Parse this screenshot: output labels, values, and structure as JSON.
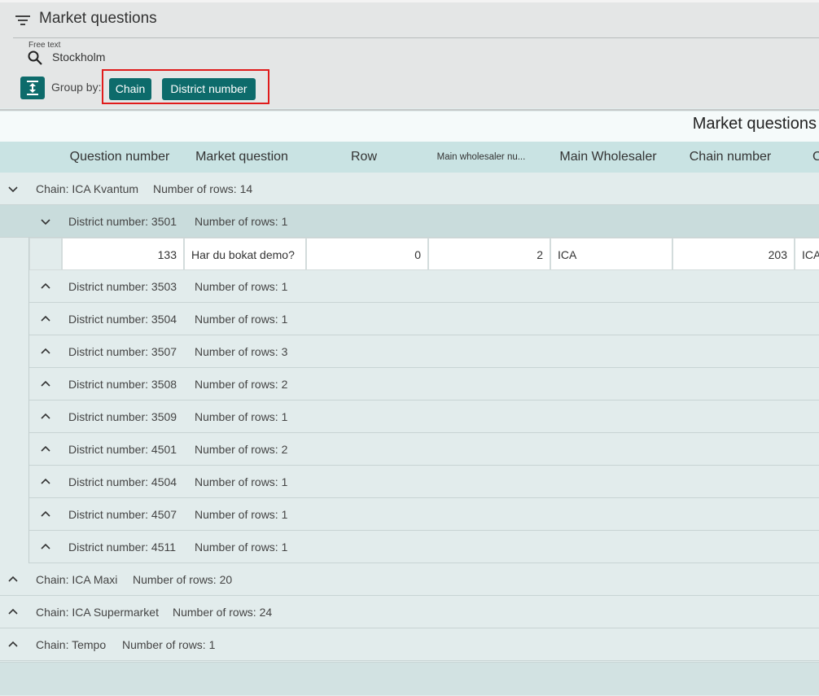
{
  "header": {
    "title": "Market questions"
  },
  "filter": {
    "label": "Free text",
    "value": "Stockholm"
  },
  "group_by": {
    "label": "Group by:",
    "chips": [
      "Chain",
      "District number"
    ]
  },
  "table": {
    "title": "Market questions",
    "columns": [
      "Question number",
      "Market question",
      "Row",
      "Main wholesaler nu...",
      "Main Wholesaler",
      "Chain number",
      "C"
    ],
    "groups": [
      {
        "label": "Chain: ICA Kvantum",
        "count": "Number of rows: 14"
      },
      {
        "label": "Chain: ICA Maxi",
        "count": "Number of rows: 20"
      },
      {
        "label": "Chain: ICA Supermarket",
        "count": "Number of rows: 24"
      },
      {
        "label": "Chain: Tempo",
        "count": "Number of rows: 1"
      }
    ],
    "subgroups": [
      {
        "label": "District number: 3501",
        "count": "Number of rows: 1"
      },
      {
        "label": "District number: 3503",
        "count": "Number of rows: 1"
      },
      {
        "label": "District number: 3504",
        "count": "Number of rows: 1"
      },
      {
        "label": "District number: 3507",
        "count": "Number of rows: 3"
      },
      {
        "label": "District number: 3508",
        "count": "Number of rows: 2"
      },
      {
        "label": "District number: 3509",
        "count": "Number of rows: 1"
      },
      {
        "label": "District number: 4501",
        "count": "Number of rows: 2"
      },
      {
        "label": "District number: 4504",
        "count": "Number of rows: 1"
      },
      {
        "label": "District number: 4507",
        "count": "Number of rows: 1"
      },
      {
        "label": "District number: 4511",
        "count": "Number of rows: 1"
      }
    ],
    "row": {
      "question_number": "133",
      "market_question": "Har du bokat demo?",
      "row": "0",
      "main_wholesaler_number": "2",
      "main_wholesaler": "ICA",
      "chain_number": "203",
      "chain": "ICA"
    }
  },
  "colors": {
    "primary": "#0d6b6b",
    "highlight": "#e01b1b",
    "header_bg": "#c9e3e3"
  }
}
